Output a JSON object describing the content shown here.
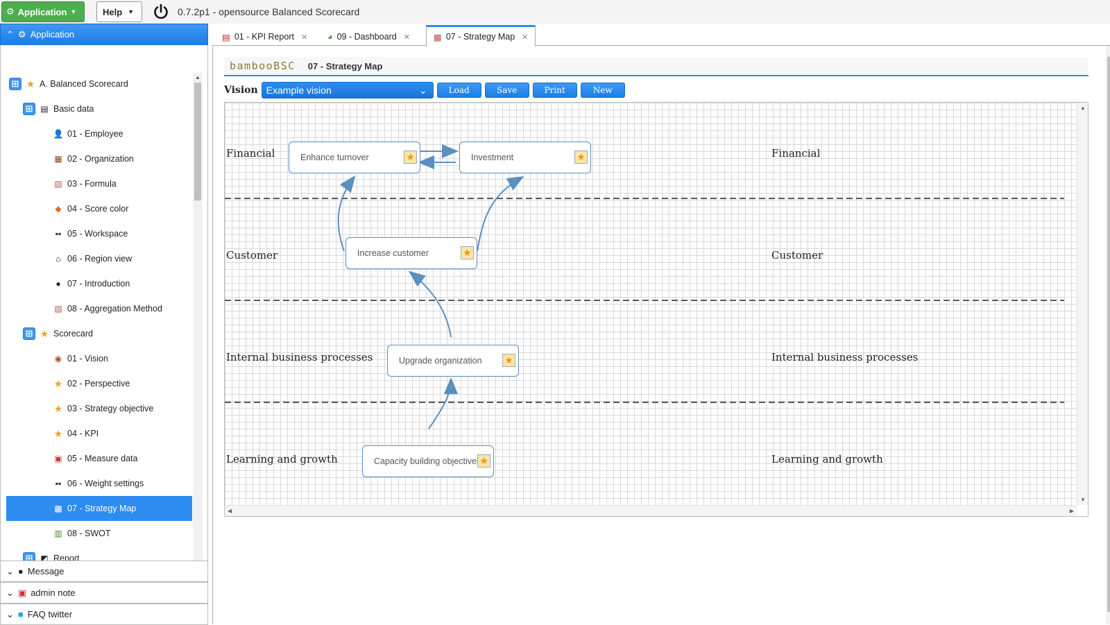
{
  "topbar": {
    "application_label": "Application",
    "help_label": "Help",
    "app_title": "0.7.2p1 - opensource Balanced Scorecard"
  },
  "left": {
    "active_panel": "Application",
    "tree": [
      {
        "label": "A. Balanced Scorecard",
        "icon": "star-icon",
        "expander": true
      },
      {
        "label": "Basic data",
        "icon": "document-icon",
        "expander": true
      },
      {
        "label": "01 - Employee",
        "icon": "person-icon"
      },
      {
        "label": "02 - Organization",
        "icon": "building-icon"
      },
      {
        "label": "03 - Formula",
        "icon": "formula-icon"
      },
      {
        "label": "04 - Score color",
        "icon": "palette-icon"
      },
      {
        "label": "05 - Workspace",
        "icon": "grid-icon"
      },
      {
        "label": "06 - Region view",
        "icon": "home-icon"
      },
      {
        "label": "07 - Introduction",
        "icon": "info-icon"
      },
      {
        "label": "08 - Aggregation Method",
        "icon": "formula-icon"
      },
      {
        "label": "Scorecard",
        "icon": "star-icon",
        "expander": true
      },
      {
        "label": "01 - Vision",
        "icon": "eye-icon"
      },
      {
        "label": "02 - Perspective",
        "icon": "star-icon"
      },
      {
        "label": "03 - Strategy objective",
        "icon": "star-icon"
      },
      {
        "label": "04 - KPI",
        "icon": "star-icon"
      },
      {
        "label": "05 - Measure data",
        "icon": "calendar-icon"
      },
      {
        "label": "06 - Weight settings",
        "icon": "grid-icon"
      },
      {
        "label": "07 - Strategy Map",
        "icon": "map-icon",
        "selected": true
      },
      {
        "label": "08 - SWOT",
        "icon": "table-icon"
      },
      {
        "label": "Report",
        "icon": "report-icon",
        "expander": true
      }
    ],
    "panels": [
      {
        "label": "Message",
        "icon": "info-icon"
      },
      {
        "label": "admin note",
        "icon": "calendar-icon"
      },
      {
        "label": "FAQ twitter",
        "icon": "twitter-icon"
      }
    ]
  },
  "tabs": [
    {
      "label": "01 - KPI Report",
      "icon": "pdf-icon"
    },
    {
      "label": "09 - Dashboard",
      "icon": "pie-icon"
    },
    {
      "label": "07 - Strategy Map",
      "icon": "map-icon",
      "active": true
    }
  ],
  "page": {
    "brand": "bambooBSC",
    "title": "07 - Strategy Map"
  },
  "toolbar": {
    "vision_label": "Vision",
    "vision_value": "Example vision",
    "load_label": "Load",
    "save_label": "Save",
    "print_label": "Print",
    "new_label": "New"
  },
  "map": {
    "perspectives": [
      "Financial",
      "Customer",
      "Internal business processes",
      "Learning and growth"
    ],
    "objectives": [
      {
        "id": "o1",
        "label": "Enhance turnover"
      },
      {
        "id": "o2",
        "label": "Investment"
      },
      {
        "id": "o3",
        "label": "Increase customer"
      },
      {
        "id": "o4",
        "label": "Upgrade organization"
      },
      {
        "id": "o5",
        "label": "Capacity building objectives"
      }
    ],
    "colors": {
      "link": "#5a8fbf",
      "accent": "#2d8cf0",
      "star": "#f0a030"
    }
  }
}
